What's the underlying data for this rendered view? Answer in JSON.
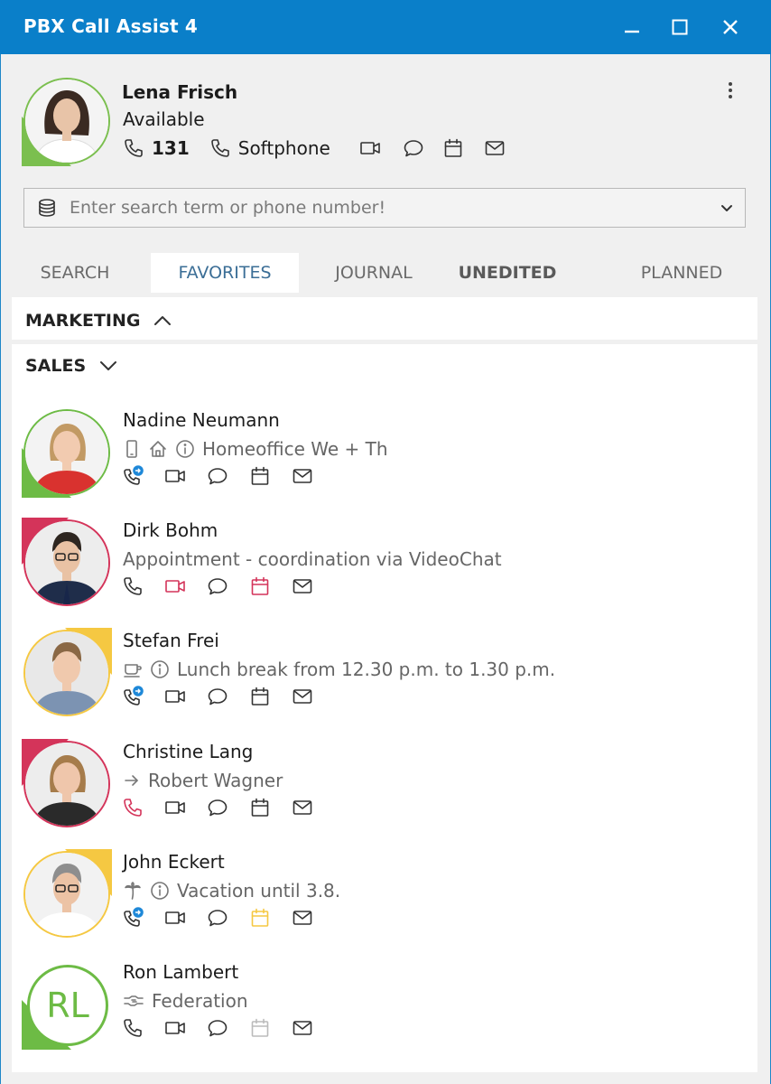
{
  "window": {
    "title": "PBX Call Assist 4"
  },
  "me": {
    "name": "Lena Frisch",
    "status": "Available",
    "extension": "131",
    "device": "Softphone",
    "presence_color": "#7bbf4f"
  },
  "search": {
    "placeholder": "Enter search term or phone number!"
  },
  "tabs": [
    "SEARCH",
    "FAVORITES",
    "JOURNAL",
    "UNEDITED",
    "PLANNED"
  ],
  "groups": [
    {
      "label": "MARKETING",
      "expanded": true,
      "chevron": "chevron-up-icon"
    },
    {
      "label": "SALES",
      "expanded": false,
      "chevron": "chevron-down-icon"
    }
  ],
  "contacts": [
    {
      "name": "Nadine Neumann",
      "status": "Homeoffice We + Th",
      "presence": "available",
      "presence_color": "#6dbb45",
      "status_icons": [
        "mobile-icon",
        "home-icon",
        "info-icon"
      ],
      "phone_icon": "phone-forward-icon",
      "video_color": "#333",
      "calendar_color": "#333",
      "phone_color": "#333"
    },
    {
      "name": "Dirk Bohm",
      "status": "Appointment - coordination via VideoChat",
      "presence": "busy",
      "presence_color": "#d4345a",
      "status_icons": [],
      "phone_icon": "phone-icon",
      "video_color": "#d4345a",
      "calendar_color": "#d4345a",
      "phone_color": "#333"
    },
    {
      "name": "Stefan Frei",
      "status": "Lunch break from 12.30 p.m. to 1.30 p.m.",
      "presence": "away",
      "presence_color": "#f5c842",
      "status_icons": [
        "coffee-icon",
        "info-icon"
      ],
      "phone_icon": "phone-forward-icon",
      "video_color": "#333",
      "calendar_color": "#333",
      "phone_color": "#333"
    },
    {
      "name": "Christine Lang",
      "status": "Robert Wagner",
      "presence": "busy",
      "presence_color": "#d4345a",
      "status_icons": [
        "arrow-right-icon"
      ],
      "phone_icon": "phone-icon",
      "video_color": "#333",
      "calendar_color": "#333",
      "phone_color": "#d4345a"
    },
    {
      "name": "John Eckert",
      "status": "Vacation until 3.8.",
      "presence": "away",
      "presence_color": "#f5c842",
      "status_icons": [
        "palm-tree-icon",
        "info-icon"
      ],
      "phone_icon": "phone-forward-icon",
      "video_color": "#333",
      "calendar_color": "#f5c842",
      "phone_color": "#333"
    },
    {
      "name": "Ron Lambert",
      "initials": "RL",
      "status": "Federation",
      "presence": "available",
      "presence_color": "#6dbb45",
      "status_icons": [
        "handshake-icon"
      ],
      "phone_icon": "phone-icon",
      "video_color": "#333",
      "calendar_color": "#bbbbbb",
      "phone_color": "#333"
    }
  ]
}
